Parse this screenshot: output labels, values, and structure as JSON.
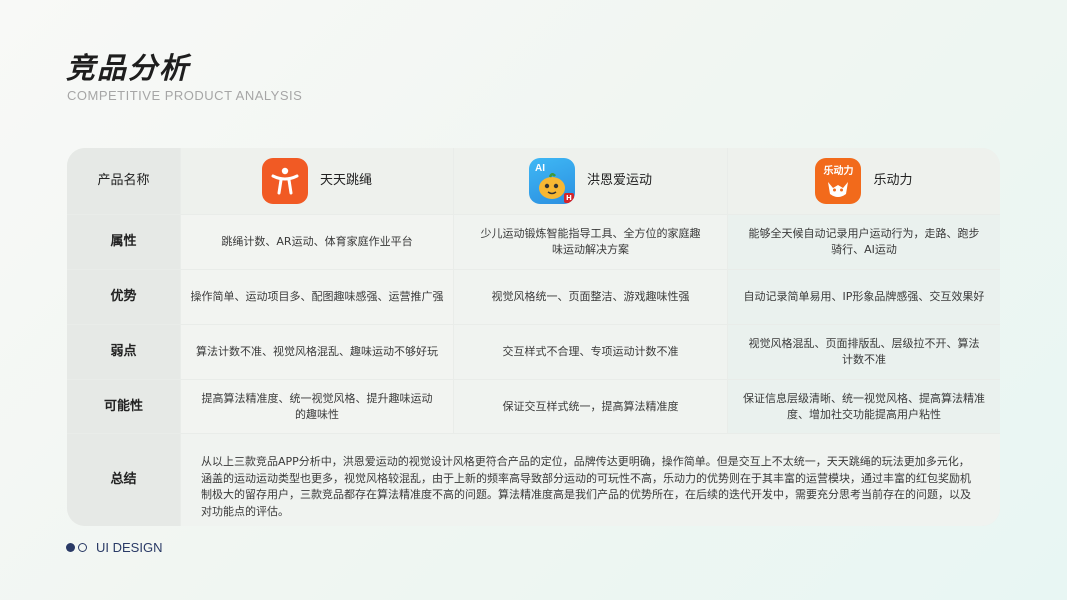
{
  "header": {
    "title": "竞品分析",
    "subtitle": "COMPETITIVE PRODUCT  ANALYSIS"
  },
  "table": {
    "header_label": "产品名称",
    "products": [
      {
        "name": "天天跳绳",
        "icon": "running-person-icon",
        "color": "#f15a24"
      },
      {
        "name": "洪恩爱运动",
        "icon": "hongen-mascot-icon",
        "color": "#2b8fe0",
        "icon_text": "AI",
        "badge": "H"
      },
      {
        "name": "乐动力",
        "icon": "ledongli-logo-icon",
        "color": "#f26a1b",
        "icon_text": "乐动力"
      }
    ],
    "rows": [
      {
        "label": "属性",
        "values": [
          "跳绳计数、AR运动、体育家庭作业平台",
          "少儿运动锻炼智能指导工具、全方位的家庭趣味运动解决方案",
          "能够全天候自动记录用户运动行为，走路、跑步骑行、AI运动"
        ]
      },
      {
        "label": "优势",
        "values": [
          "操作简单、运动项目多、配图趣味感强、运营推广强",
          "视觉风格统一、页面整洁、游戏趣味性强",
          "自动记录简单易用、IP形象品牌感强、交互效果好"
        ]
      },
      {
        "label": "弱点",
        "values": [
          "算法计数不准、视觉风格混乱、趣味运动不够好玩",
          "交互样式不合理、专项运动计数不准",
          "视觉风格混乱、页面排版乱、层级拉不开、算法计数不准"
        ]
      },
      {
        "label": "可能性",
        "values": [
          "提高算法精准度、统一视觉风格、提升趣味运动的趣味性",
          "保证交互样式统一，提高算法精准度",
          "保证信息层级清晰、统一视觉风格、提高算法精准度、增加社交功能提高用户粘性"
        ]
      }
    ],
    "summary": {
      "label": "总结",
      "text": "从以上三款竞品APP分析中，洪恩爱运动的视觉设计风格更符合产品的定位，品牌传达更明确，操作简单。但是交互上不太统一，天天跳绳的玩法更加多元化，涵盖的运动运动类型也更多，视觉风格较混乱，由于上新的频率高导致部分运动的可玩性不高，乐动力的优势则在于其丰富的运营模块，通过丰富的红包奖励机制极大的留存用户，三款竞品都存在算法精准度不高的问题。算法精准度高是我们产品的优势所在，在后续的迭代开发中，需要充分思考当前存在的问题，以及对功能点的评估。"
    }
  },
  "footer": {
    "label": "UI DESIGN",
    "accent": "#2a3a66"
  }
}
